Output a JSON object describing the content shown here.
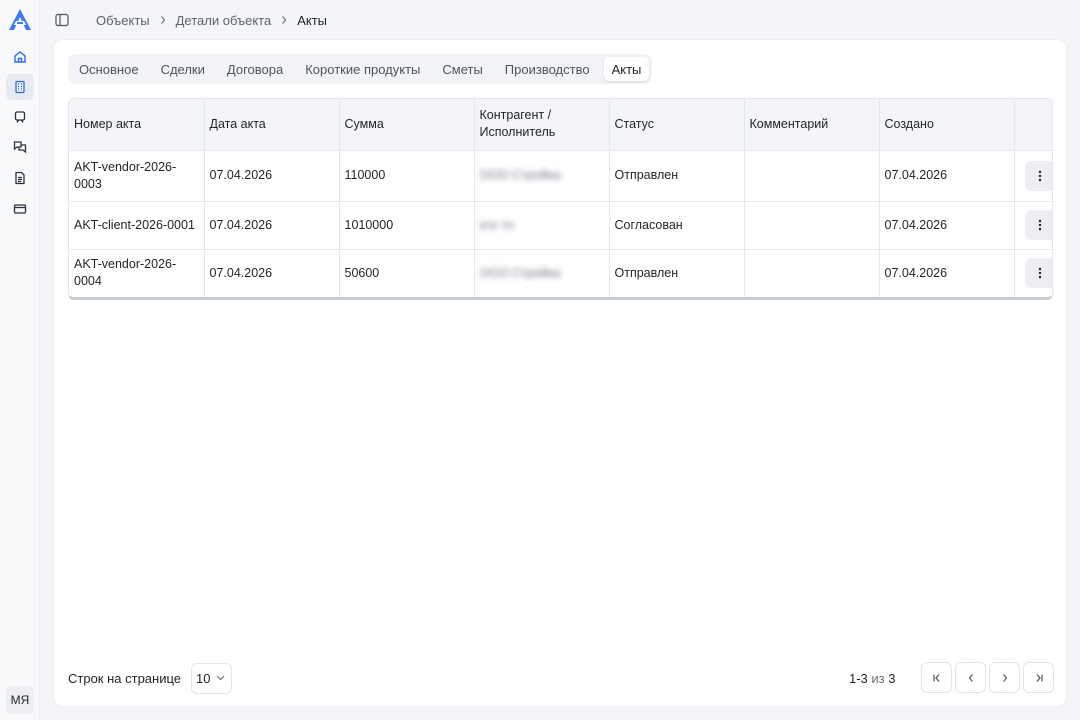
{
  "sidebar": {
    "avatar_initials": "МЯ",
    "items": [
      {
        "icon": "home-icon"
      },
      {
        "icon": "building-icon"
      },
      {
        "icon": "device-icon"
      },
      {
        "icon": "chat-icon"
      },
      {
        "icon": "document-icon"
      },
      {
        "icon": "card-icon"
      }
    ]
  },
  "breadcrumb": {
    "items": [
      "Объекты",
      "Детали объекта",
      "Акты"
    ],
    "separator": ">"
  },
  "tabs": [
    "Основное",
    "Сделки",
    "Договора",
    "Короткие продукты",
    "Сметы",
    "Производство",
    "Акты"
  ],
  "active_tab": "Акты",
  "table": {
    "columns": [
      "Номер акта",
      "Дата акта",
      "Сумма",
      "Контрагент / Исполнитель",
      "Статус",
      "Комментарий",
      "Создано"
    ],
    "rows": [
      {
        "number": "AKT-vendor-2026-0003",
        "date": "07.04.2026",
        "sum": "110000",
        "counterparty": "ООО Стройка",
        "status": "Отправлен",
        "comment": "",
        "created": "07.04.2026"
      },
      {
        "number": "AKT-client-2026-0001",
        "date": "07.04.2026",
        "sum": "1010000",
        "counterparty": "кто то",
        "status": "Согласован",
        "comment": "",
        "created": "07.04.2026"
      },
      {
        "number": "AKT-vendor-2026-0004",
        "date": "07.04.2026",
        "sum": "50600",
        "counterparty": "ООО Стройка",
        "status": "Отправлен",
        "comment": "",
        "created": "07.04.2026"
      }
    ]
  },
  "footer": {
    "rows_per_page_label": "Строк на странице",
    "rows_per_page_value": "10",
    "range": "1-3",
    "of": "из",
    "total": "3"
  },
  "colors": {
    "accent": "#2f6fe4",
    "background": "#f3f5f9"
  }
}
